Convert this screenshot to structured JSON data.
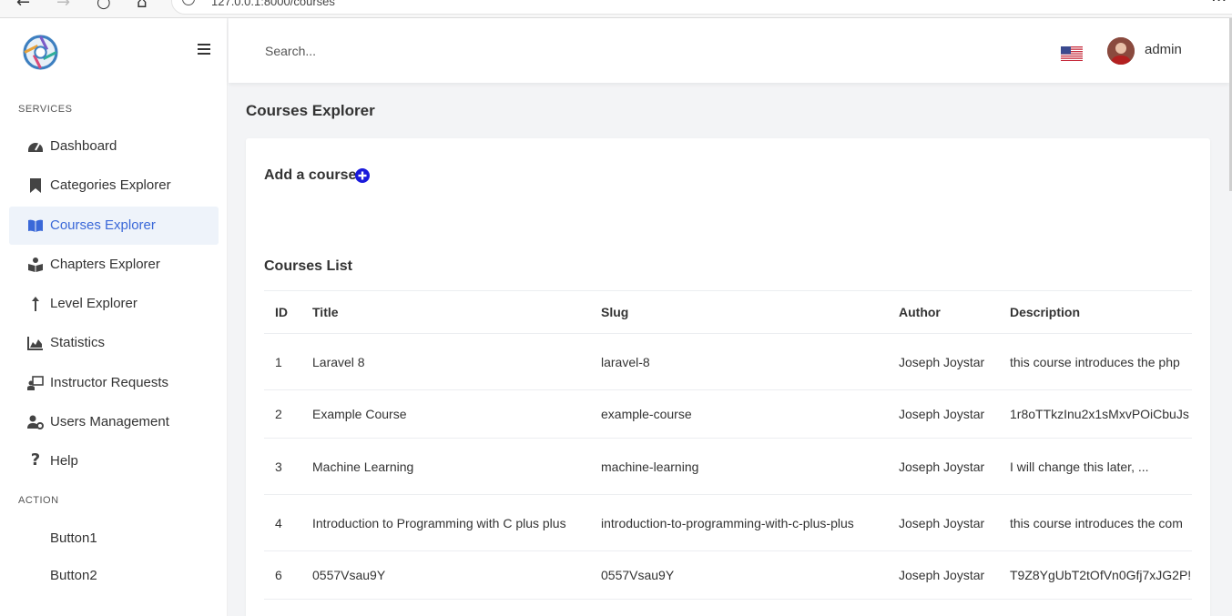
{
  "browser": {
    "url": "127.0.0.1:8000/courses",
    "back_icon": "arrow-left-icon",
    "forward_icon": "arrow-right-icon",
    "reload_icon": "reload-icon",
    "home_icon": "home-icon"
  },
  "sidebar": {
    "logo_icon": "aperture-logo-icon",
    "menu_icon": "hamburger-icon",
    "services_label": "SERVICES",
    "items": [
      {
        "label": "Dashboard",
        "icon": "speedometer-icon"
      },
      {
        "label": "Categories Explorer",
        "icon": "bookmark-icon"
      },
      {
        "label": "Courses Explorer",
        "icon": "open-book-icon",
        "active": true
      },
      {
        "label": "Chapters Explorer",
        "icon": "book-reader-icon"
      },
      {
        "label": "Level Explorer",
        "icon": "arrow-up-icon"
      },
      {
        "label": "Statistics",
        "icon": "area-chart-icon"
      },
      {
        "label": "Instructor Requests",
        "icon": "chalkboard-teacher-icon"
      },
      {
        "label": "Users Management",
        "icon": "users-cog-icon"
      },
      {
        "label": "Help",
        "icon": "question-icon"
      }
    ],
    "action_label": "ACTION",
    "actions": [
      {
        "label": "Button1"
      },
      {
        "label": "Button2"
      }
    ]
  },
  "header": {
    "search_placeholder": "Search...",
    "flag_icon": "us-flag-icon",
    "user_name": "admin"
  },
  "main": {
    "page_title": "Courses Explorer",
    "add_course_label": "Add a course",
    "add_icon": "plus-circle-icon",
    "list_title": "Courses List",
    "columns": [
      "ID",
      "Title",
      "Slug",
      "Author",
      "Description"
    ],
    "rows": [
      {
        "id": "1",
        "title": "Laravel 8",
        "slug": "laravel-8",
        "author": "Joseph Joystar",
        "description": "this course introduces the php"
      },
      {
        "id": "2",
        "title": "Example Course",
        "slug": "example-course",
        "author": "Joseph Joystar",
        "description": "1r8oTTkzInu2x1sMxvPOiCbuJs"
      },
      {
        "id": "3",
        "title": "Machine Learning",
        "slug": "machine-learning",
        "author": "Joseph Joystar",
        "description": "I will change this later, ..."
      },
      {
        "id": "4",
        "title": "Introduction to Programming with C plus plus",
        "slug": "introduction-to-programming-with-c-plus-plus",
        "author": "Joseph Joystar",
        "description": "this course introduces the com"
      },
      {
        "id": "6",
        "title": "0557Vsau9Y",
        "slug": "0557Vsau9Y",
        "author": "Joseph Joystar",
        "description": "T9Z8YgUbT2tOfVn0Gfj7xJG2P!"
      }
    ]
  },
  "colors": {
    "accent": "#3a68d8",
    "active_bg": "#eef3fa",
    "add_icon": "#1a1adb"
  }
}
